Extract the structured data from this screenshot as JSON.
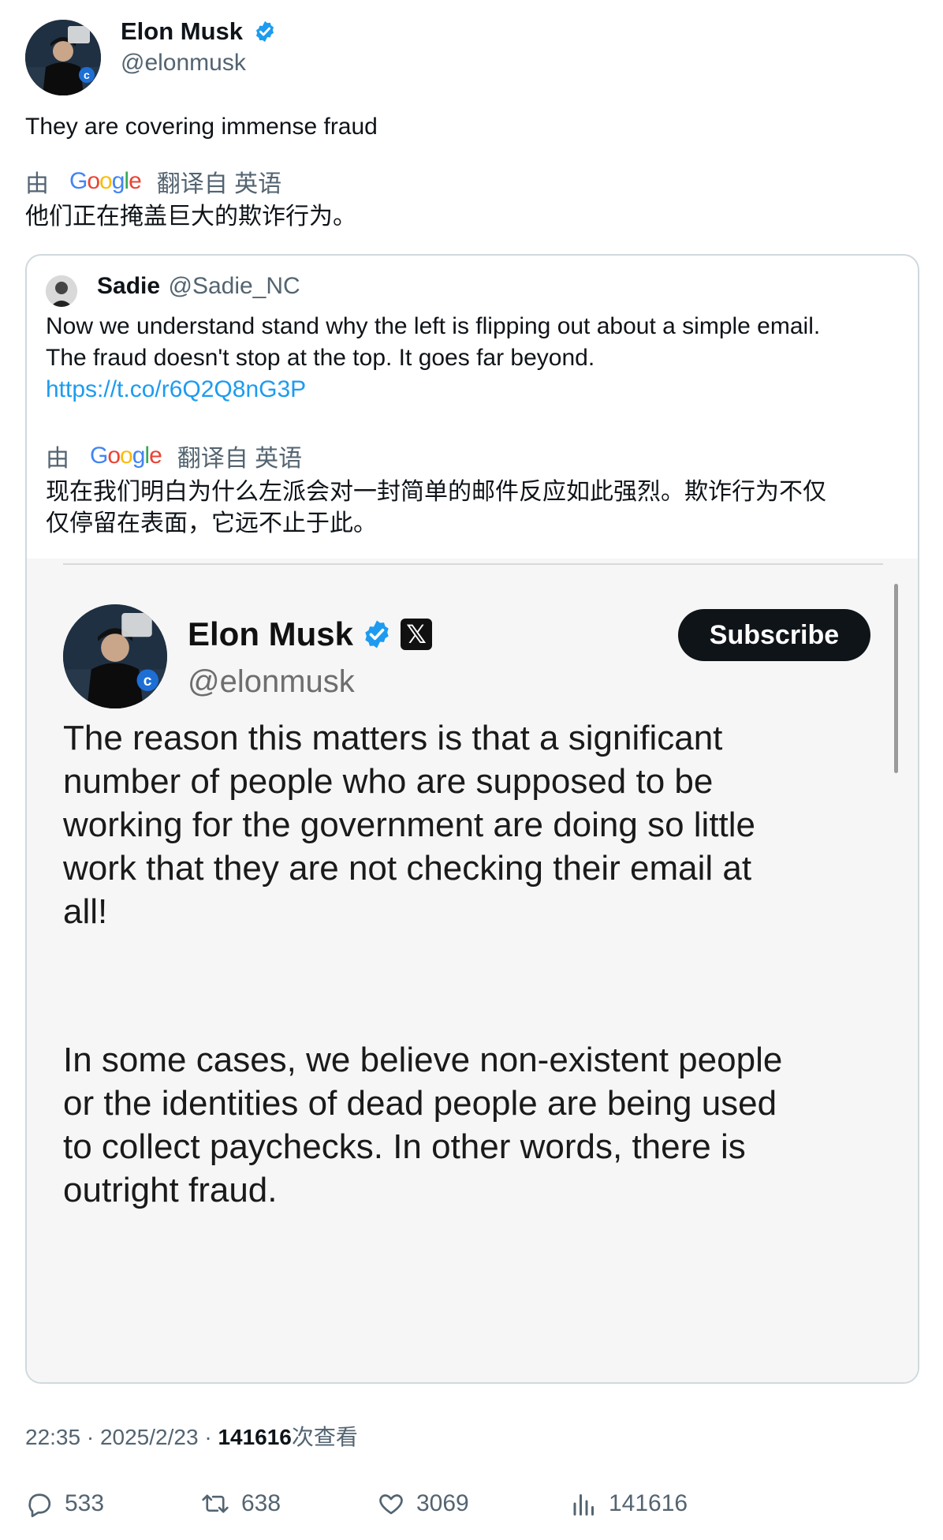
{
  "author": {
    "name": "Elon Musk",
    "handle": "@elonmusk"
  },
  "tweet": {
    "text": "They are covering immense fraud",
    "translate_prefix": "由",
    "translate_suffix": "翻译自 英语",
    "translation": "他们正在掩盖巨大的欺诈行为。"
  },
  "google_logo": [
    "G",
    "o",
    "o",
    "g",
    "l",
    "e"
  ],
  "quote": {
    "name": "Sadie",
    "handle": "@Sadie_NC",
    "text_line1": "Now we understand stand why the left is flipping out about a simple email.",
    "text_line2": "The fraud doesn't stop at the top. It goes far beyond.",
    "link": "https://t.co/r6Q2Q8nG3P",
    "translate_prefix": "由",
    "translate_suffix": "翻译自 英语",
    "translation_line1": "现在我们明白为什么左派会对一封简单的邮件反应如此强烈。欺诈行为不仅",
    "translation_line2": "仅停留在表面，它远不止于此。"
  },
  "media": {
    "name": "Elon Musk",
    "handle": "@elonmusk",
    "x_badge": "𝕏",
    "subscribe_label": "Subscribe",
    "para1": [
      "The reason this matters is that a significant",
      "number of people who are supposed to be",
      "working for the government are doing so little",
      "work that they are not checking their email at",
      "all!"
    ],
    "para2": [
      "In some cases, we believe non-existent people",
      "or the identities of dead people are being used",
      "to collect paychecks. In other words, there is",
      "outright fraud."
    ]
  },
  "meta": {
    "time": "22:35",
    "sep1": "·",
    "date": "2025/2/23",
    "sep2": "·",
    "views": "141616",
    "views_suffix": "次查看"
  },
  "actions": {
    "replies": "533",
    "retweets": "638",
    "likes": "3069",
    "views": "141616"
  },
  "colors": {
    "accent": "#1d9bf0",
    "text": "#0f1419",
    "secondary": "#536471"
  }
}
